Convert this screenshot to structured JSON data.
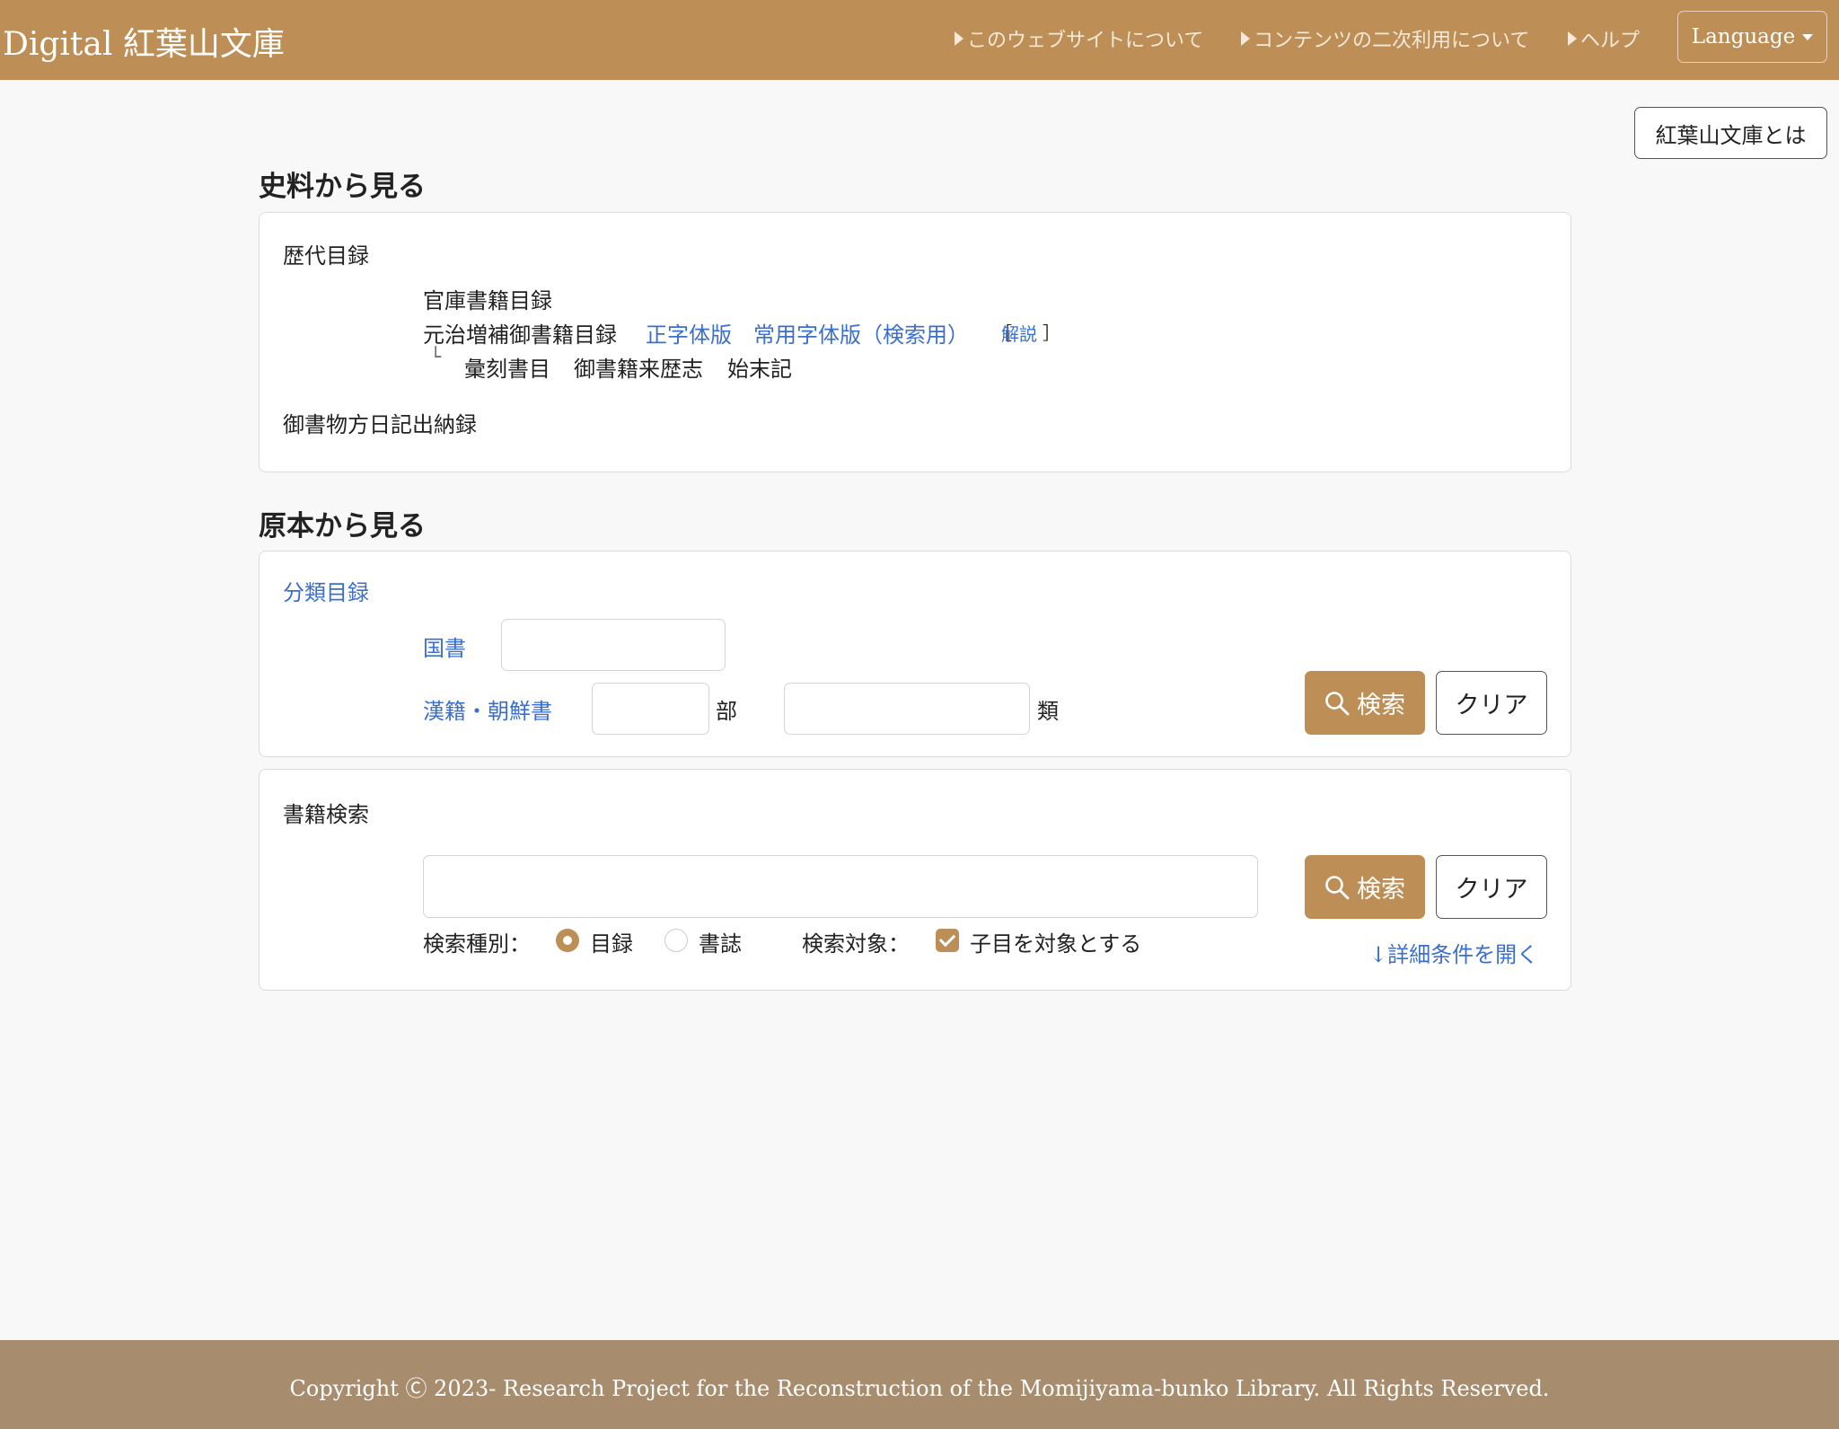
{
  "header": {
    "brand": "Digital 紅葉山文庫",
    "nav": [
      {
        "label": "このウェブサイトについて"
      },
      {
        "label": "コンテンツの二次利用について"
      },
      {
        "label": "ヘルプ"
      }
    ],
    "language_label": "Language"
  },
  "about_button": "紅葉山文庫とは",
  "section1": {
    "title": "史料から見る",
    "group_label": "歴代目録",
    "item1": "官庫書籍目録",
    "item2": {
      "label": "元治増補御書籍目録",
      "link1": "正字体版",
      "link2": "常用字体版（検索用）",
      "bracket_open": "［",
      "note": "解説",
      "bracket_close": "］"
    },
    "branch_mark": "└",
    "sub_items": [
      "彙刻書目",
      "御書籍来歴志",
      "始末記"
    ],
    "item3": "御書物方日記出納録"
  },
  "section2": {
    "title": "原本から見る",
    "card1": {
      "heading": "分類目録",
      "kokusho_label": "国書",
      "kanseki_label": "漢籍・朝鮮書",
      "bu_label": "部",
      "rui_label": "類",
      "kokusho_value": "",
      "bu_value": "",
      "rui_value": "",
      "search_label": "検索",
      "clear_label": "クリア"
    },
    "card2": {
      "heading": "書籍検索",
      "query_value": "",
      "search_label": "検索",
      "clear_label": "クリア",
      "type_label": "検索種別：",
      "type_options": [
        {
          "label": "目録",
          "selected": true
        },
        {
          "label": "書誌",
          "selected": false
        }
      ],
      "target_label": "検索対象：",
      "target_option": {
        "label": "子目を対象とする",
        "checked": true
      },
      "advanced_link": "↓詳細条件を開く"
    }
  },
  "footer": {
    "copyright": "Copyright Ⓒ 2023- Research Project for the Reconstruction of the Momijiyama-bunko Library. All Rights Reserved."
  },
  "colors": {
    "brand": "#bd8f56",
    "footer": "#a78d6d",
    "link": "#3b6fce"
  }
}
